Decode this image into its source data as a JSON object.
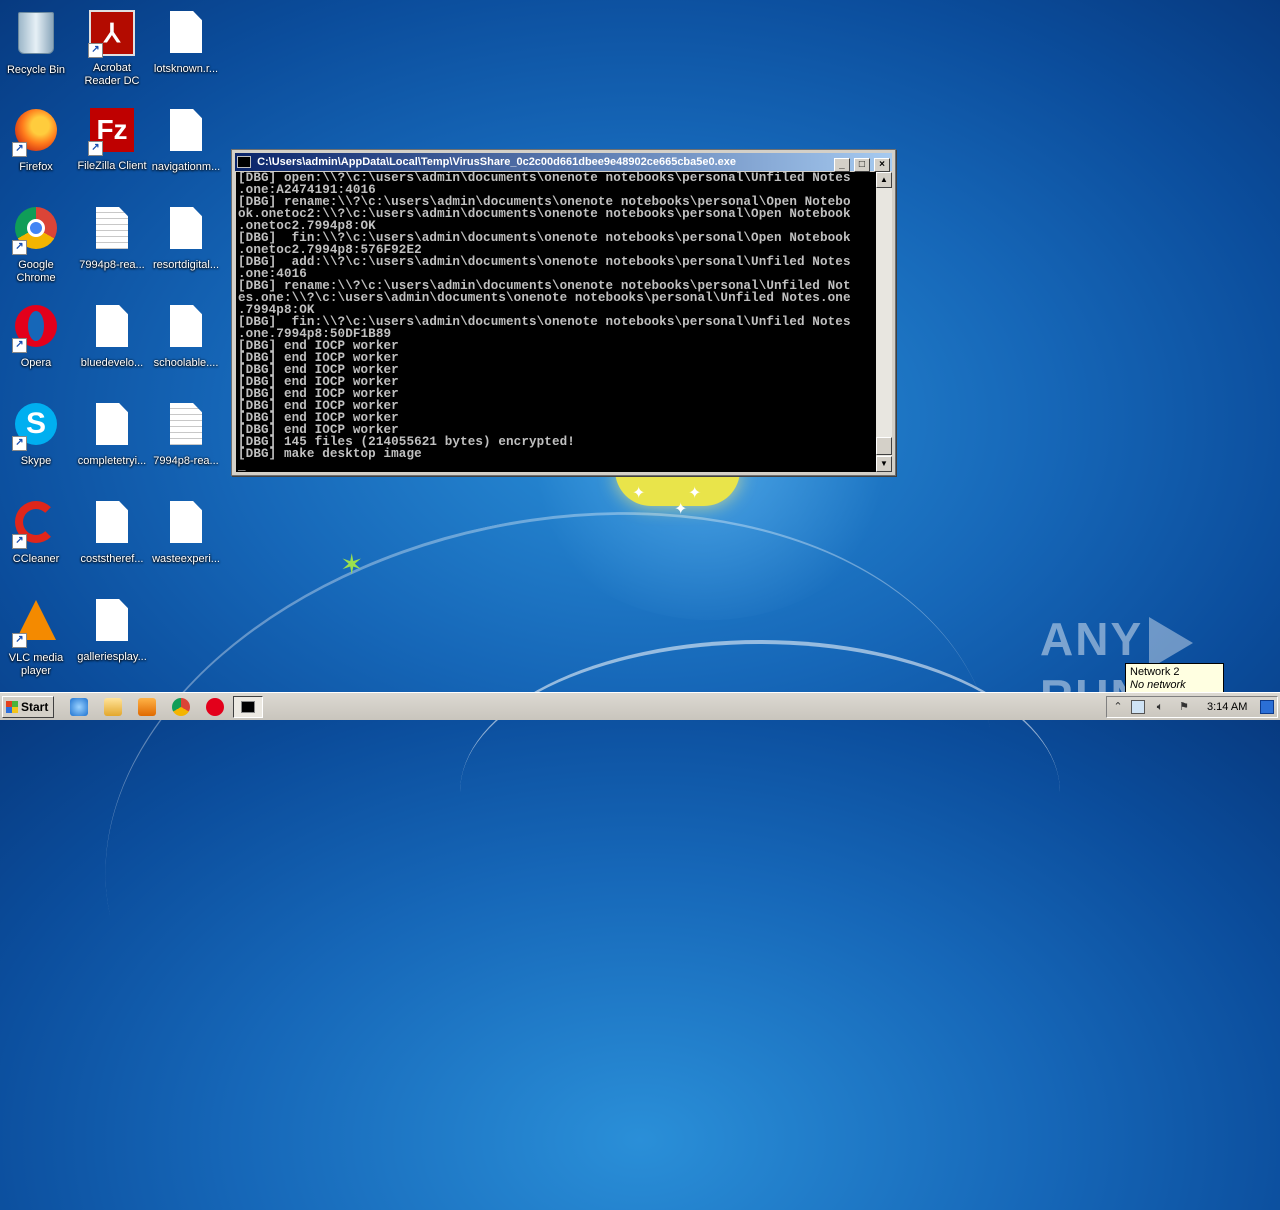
{
  "desktop": {
    "icons": [
      {
        "label": "Recycle Bin",
        "icon": "recycle-bin-icon"
      },
      {
        "label": "Acrobat Reader DC",
        "icon": "acrobat-reader-icon"
      },
      {
        "label": "lotsknown.r...",
        "icon": "document-icon"
      },
      {
        "label": "Firefox",
        "icon": "firefox-icon"
      },
      {
        "label": "FileZilla Client",
        "icon": "filezilla-icon"
      },
      {
        "label": "navigationm...",
        "icon": "document-icon"
      },
      {
        "label": "Google Chrome",
        "icon": "chrome-icon"
      },
      {
        "label": "7994p8-rea...",
        "icon": "text-document-icon"
      },
      {
        "label": "resortdigital...",
        "icon": "document-icon"
      },
      {
        "label": "Opera",
        "icon": "opera-icon"
      },
      {
        "label": "bluedevelo...",
        "icon": "document-icon"
      },
      {
        "label": "schoolable....",
        "icon": "document-icon"
      },
      {
        "label": "Skype",
        "icon": "skype-icon"
      },
      {
        "label": "completetryi...",
        "icon": "document-icon"
      },
      {
        "label": "7994p8-rea...",
        "icon": "text-document-icon"
      },
      {
        "label": "CCleaner",
        "icon": "ccleaner-icon"
      },
      {
        "label": "coststheref...",
        "icon": "document-icon"
      },
      {
        "label": "wasteexperi...",
        "icon": "document-icon"
      },
      {
        "label": "VLC media player",
        "icon": "vlc-icon"
      },
      {
        "label": "galleriesplay...",
        "icon": "document-icon"
      }
    ]
  },
  "console_window": {
    "title": "C:\\Users\\admin\\AppData\\Local\\Temp\\VirusShare_0c2c00d661dbee9e48902ce665cba5e0.exe",
    "buttons": {
      "minimize": "_",
      "maximize": "□",
      "close": "×"
    },
    "lines": [
      "[DBG] open:\\\\?\\c:\\users\\admin\\documents\\onenote notebooks\\personal\\Unfiled Notes",
      ".one:A2474191:4016",
      "[DBG] rename:\\\\?\\c:\\users\\admin\\documents\\onenote notebooks\\personal\\Open Notebo",
      "ok.onetoc2:\\\\?\\c:\\users\\admin\\documents\\onenote notebooks\\personal\\Open Notebook",
      ".onetoc2.7994p8:OK",
      "[DBG]  fin:\\\\?\\c:\\users\\admin\\documents\\onenote notebooks\\personal\\Open Notebook",
      ".onetoc2.7994p8:576F92E2",
      "[DBG]  add:\\\\?\\c:\\users\\admin\\documents\\onenote notebooks\\personal\\Unfiled Notes",
      ".one:4016",
      "[DBG] rename:\\\\?\\c:\\users\\admin\\documents\\onenote notebooks\\personal\\Unfiled Not",
      "es.one:\\\\?\\c:\\users\\admin\\documents\\onenote notebooks\\personal\\Unfiled Notes.one",
      ".7994p8:OK",
      "[DBG]  fin:\\\\?\\c:\\users\\admin\\documents\\onenote notebooks\\personal\\Unfiled Notes",
      ".one.7994p8:50DF1B89",
      "[DBG] end IOCP worker",
      "[DBG] end IOCP worker",
      "[DBG] end IOCP worker",
      "[DBG] end IOCP worker",
      "[DBG] end IOCP worker",
      "[DBG] end IOCP worker",
      "[DBG] end IOCP worker",
      "[DBG] end IOCP worker",
      "[DBG] 145 files (214055621 bytes) encrypted!",
      "[DBG] make desktop image"
    ],
    "cursor": "_"
  },
  "watermark": {
    "left": "ANY",
    "right": "RUN"
  },
  "network_tooltip": {
    "title": "Network  2",
    "status": "No network access"
  },
  "taskbar": {
    "start_label": "Start",
    "quick_launch": [
      "internet-explorer-icon",
      "explorer-folder-icon",
      "media-player-icon",
      "chrome-icon",
      "opera-icon"
    ],
    "clock": "3:14 AM",
    "tray_icons": [
      "show-hidden-icons-arrow",
      "network-icon",
      "volume-icon",
      "action-center-flag-icon"
    ]
  }
}
